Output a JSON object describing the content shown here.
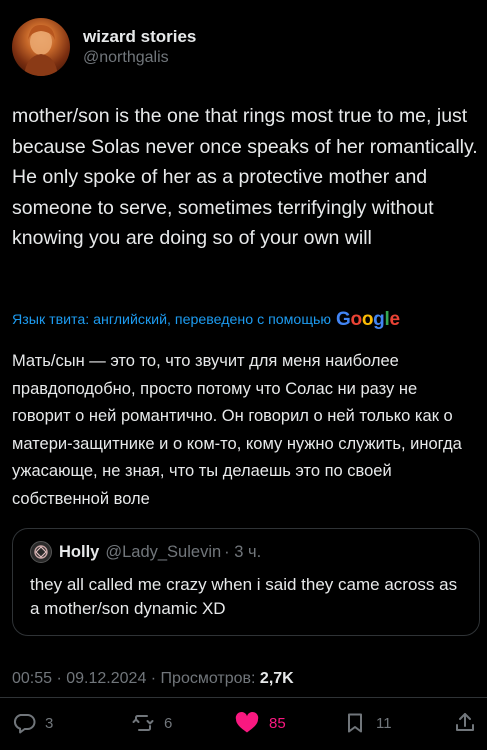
{
  "author": {
    "display_name": "wizard stories",
    "handle": "@northgalis"
  },
  "tweet": {
    "text": "mother/son is the one that rings most true to me, just because Solas never once speaks of her romantically. He only spoke of her as a protective mother and someone to serve, sometimes terrifyingly without knowing you are doing so of your own will",
    "translation_label": "Язык твита: английский, переведено с помощью",
    "translation_provider": "Google",
    "translated_text": "Мать/сын — это то, что звучит для меня наиболее правдоподобно, просто потому что Солас ни разу не говорит о ней романтично. Он говорил о ней только как о матери-защитнике и о ком-то, кому нужно служить, иногда ужасающе, не зная, что ты делаешь это по своей собственной воле"
  },
  "quote": {
    "display_name": "Holly",
    "handle": "@Lady_Sulevin",
    "time": "· 3 ч.",
    "text": "they all called me crazy when i said they came across as a mother/son dynamic XD"
  },
  "meta": {
    "timestamp": "00:55 · 09.12.2024 · Просмотров:",
    "views": "2,7K"
  },
  "actions": {
    "replies": "3",
    "reposts": "6",
    "likes": "85",
    "bookmarks": "11"
  },
  "colors": {
    "background": "#000000",
    "text": "#e7e9ea",
    "muted": "#71767b",
    "accent": "#1d9bf0",
    "like": "#f91880",
    "border": "#2f3336"
  },
  "icons": [
    "avatar-image",
    "reply-icon",
    "repost-icon",
    "like-icon",
    "bookmark-icon",
    "share-icon",
    "google-logo"
  ]
}
